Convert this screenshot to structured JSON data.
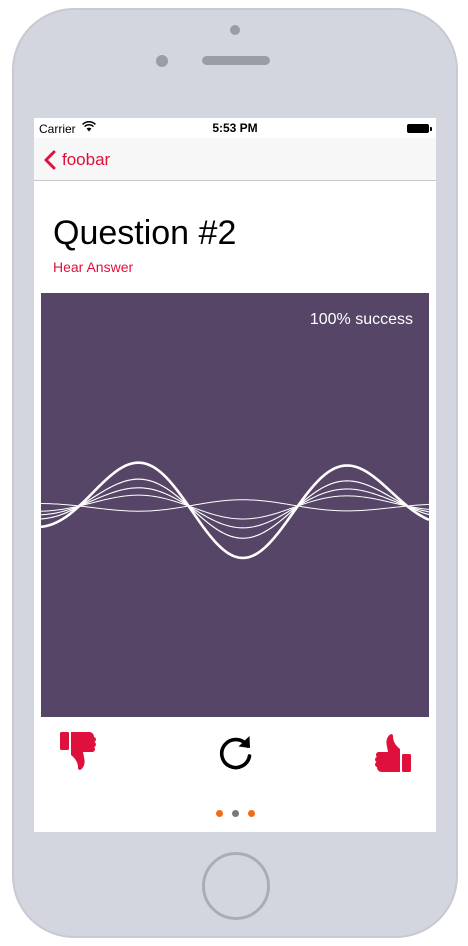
{
  "status_bar": {
    "carrier": "Carrier",
    "time": "5:53 PM"
  },
  "nav": {
    "back_label": "foobar"
  },
  "content": {
    "title": "Question #2",
    "hear_answer_label": "Hear Answer",
    "success_text": "100% success"
  },
  "actions": {
    "thumbs_down_icon": "thumbs-down-icon",
    "reload_icon": "reload-icon",
    "thumbs_up_icon": "thumbs-up-icon"
  },
  "page_control": {
    "page_count": 3,
    "current_page": 2
  },
  "colors": {
    "accent": "#e0103d",
    "panel": "#564566",
    "dot_active": "#7a7a7a",
    "dot_inactive": "#ef6c1a"
  }
}
